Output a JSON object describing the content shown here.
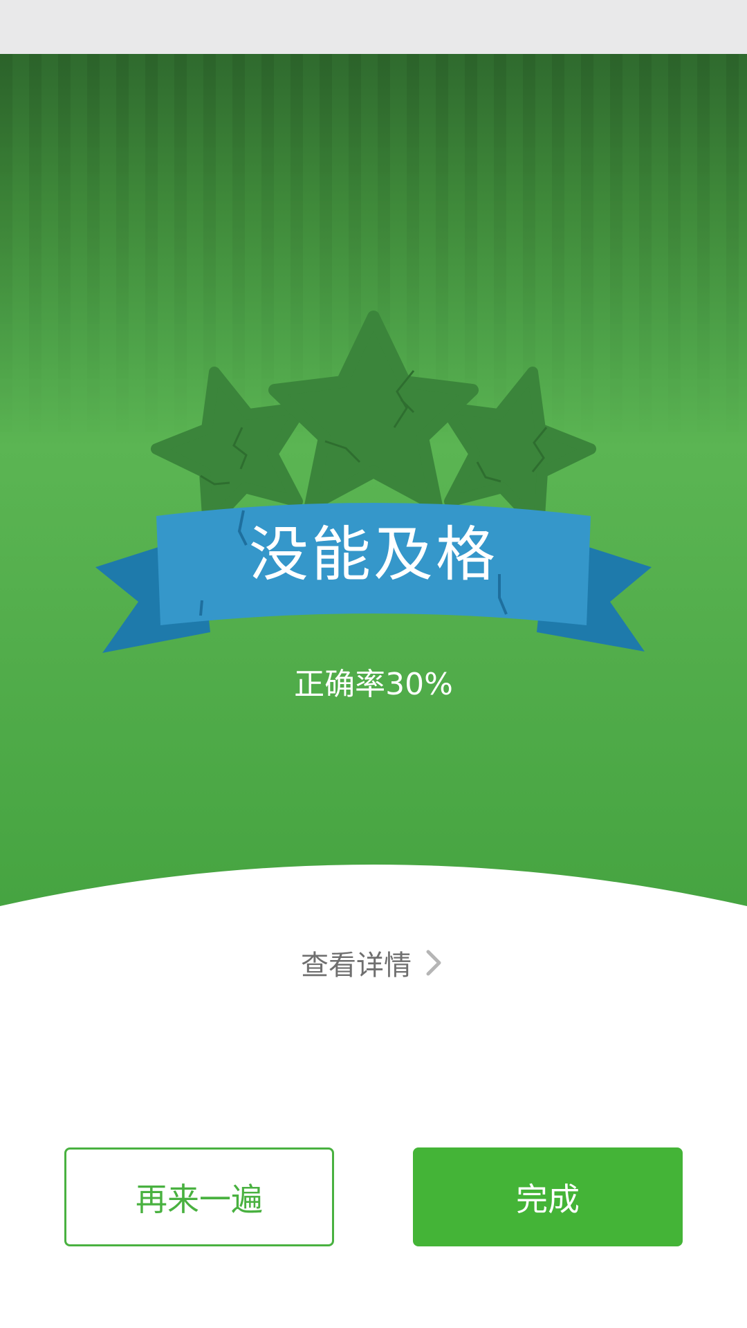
{
  "result": {
    "title": "没能及格",
    "accuracy_text": "正确率30%",
    "accuracy_percent": 30,
    "stars_earned": 0,
    "stars_total": 3
  },
  "details_link": {
    "label": "查看详情",
    "icon": "chevron-right-icon"
  },
  "buttons": {
    "retry_label": "再来一遍",
    "done_label": "完成"
  },
  "colors": {
    "hero_green": "#52ad4b",
    "star_dark_green": "#3c8a3c",
    "ribbon_blue": "#3597ca",
    "ribbon_dark_blue": "#1e7aab",
    "accent_green": "#44b437",
    "status_bar": "#e9e9ea"
  }
}
